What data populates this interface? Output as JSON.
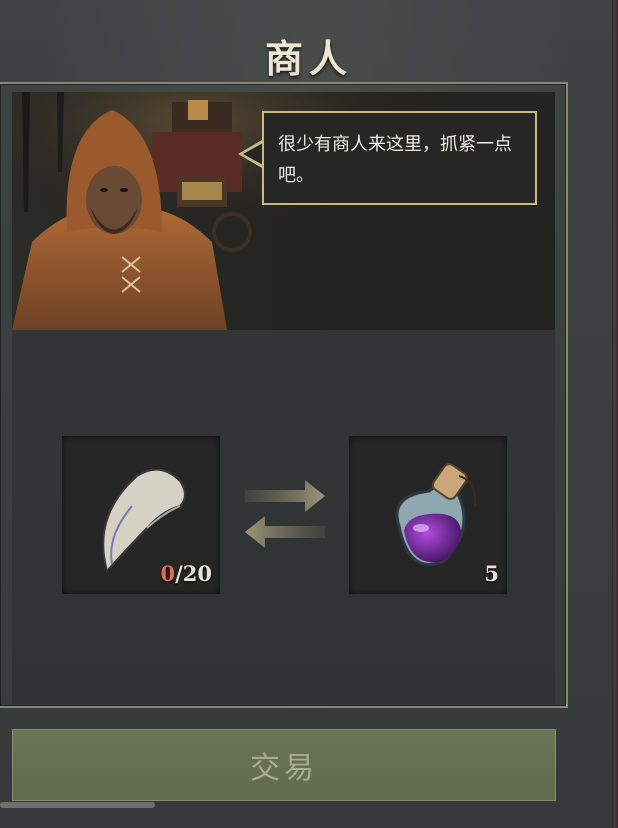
{
  "header": {
    "title": "商人"
  },
  "merchant": {
    "dialogue": "很少有商人来这里，抓紧一点吧。"
  },
  "trade": {
    "give_item": {
      "icon": "claw-icon",
      "have": "0",
      "need": "/20"
    },
    "receive_item": {
      "icon": "purple-potion-icon",
      "quantity": "5"
    }
  },
  "actions": {
    "trade_label": "交易"
  },
  "colors": {
    "accent_gold": "#c9b98a",
    "insufficient_red": "#e06a5c",
    "button_green": "#6b7658"
  }
}
